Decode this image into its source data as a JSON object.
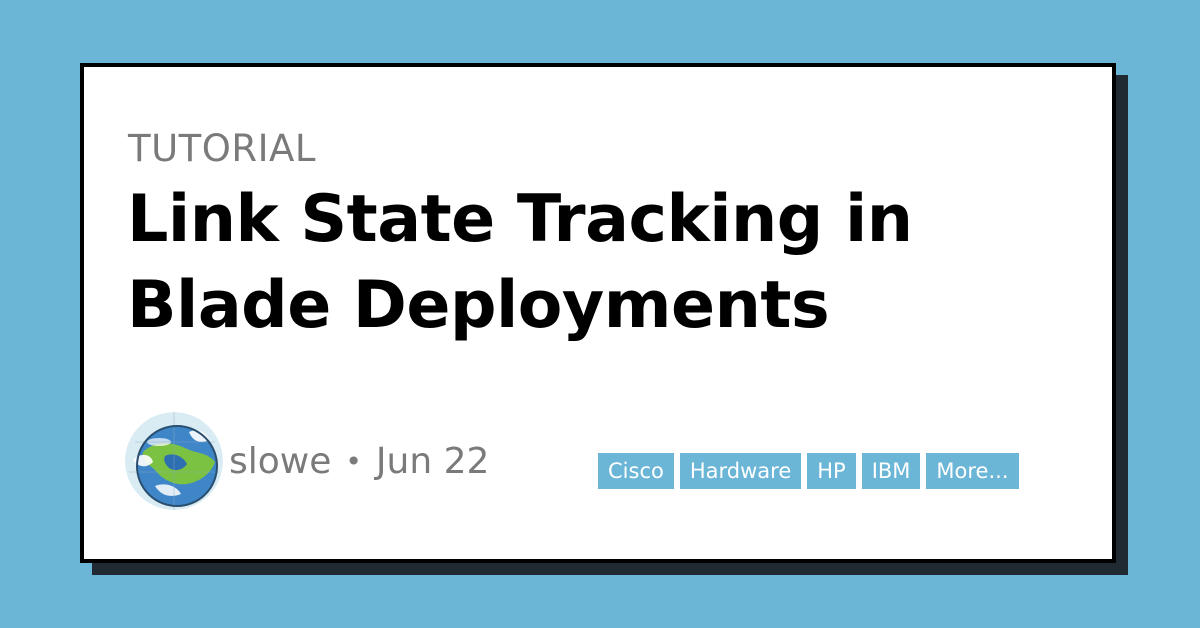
{
  "background_color": "#6bb5d6",
  "card": {
    "eyebrow": "TUTORIAL",
    "title": "Link State Tracking in Blade Deployments",
    "author": "slowe",
    "separator": "•",
    "date": "Jun 22",
    "tags": [
      "Cisco",
      "Hardware",
      "HP",
      "IBM",
      "More..."
    ]
  },
  "colors": {
    "tag_background": "#6bb5d6",
    "card_border": "#000000",
    "muted_text": "#7a7a7a"
  },
  "icons": {
    "avatar": "globe-cartoon-avatar"
  }
}
